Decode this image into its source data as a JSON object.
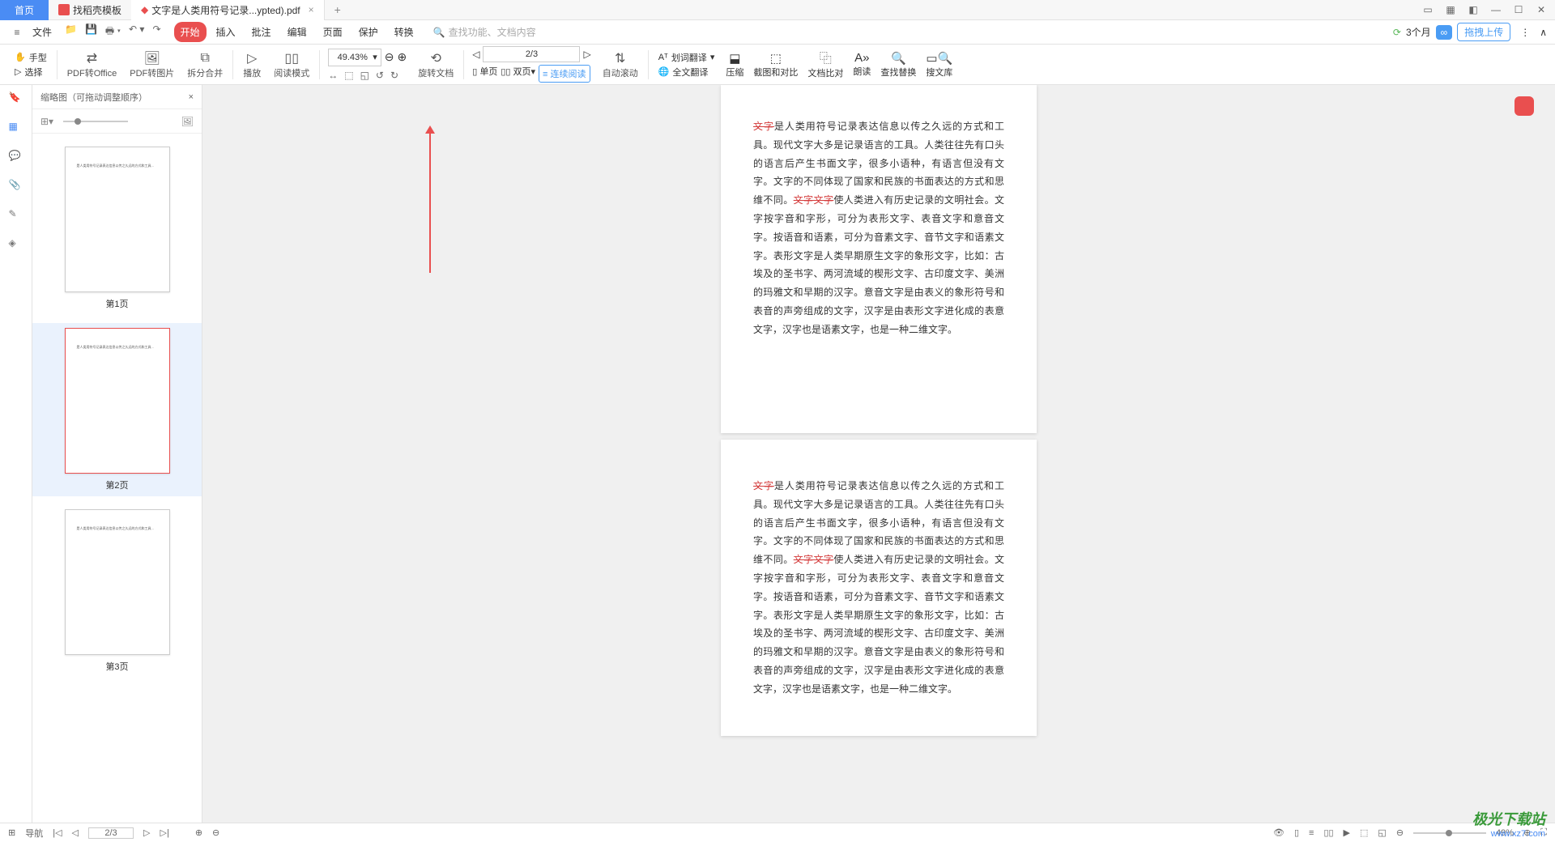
{
  "titlebar": {
    "home_tab": "首页",
    "store_tab": "找稻壳模板",
    "doc_tab": "文字是人类用符号记录...ypted).pdf"
  },
  "menubar": {
    "file": "文件",
    "tabs": [
      "开始",
      "插入",
      "批注",
      "编辑",
      "页面",
      "保护",
      "转换"
    ],
    "search_placeholder": "查找功能、文档内容",
    "cloud_text": "3个月",
    "upload": "拖拽上传"
  },
  "ribbon_left": {
    "hand": "手型",
    "select": "选择"
  },
  "ribbon": {
    "pdf_office": "PDF转Office",
    "pdf_image": "PDF转图片",
    "split_merge": "拆分合并",
    "play": "播放",
    "read_mode": "阅读模式",
    "zoom_value": "49.43%",
    "rotate": "旋转文档",
    "single_page": "单页",
    "double_page": "双页",
    "continuous": "连续阅读",
    "auto_scroll": "自动滚动",
    "page_indicator": "2/3",
    "word_translate": "划词翻译",
    "full_translate": "全文翻译",
    "compress": "压缩",
    "screenshot": "截图和对比",
    "file_compare": "文档比对",
    "read_aloud": "朗读",
    "find_replace": "查找替换",
    "search_lib": "搜文库"
  },
  "thumb": {
    "title": "缩略图（可拖动调整顺序）",
    "pages": [
      "第1页",
      "第2页",
      "第3页"
    ]
  },
  "doc_text": "是人类用符号记录表达信息以传之久远的方式和工具。现代文字大多是记录语言的工具。人类往往先有口头的语言后产生书面文字，很多小语种，有语言但没有文字。文字的不同体现了国家和民族的书面表达的方式和思维不同。",
  "doc_red1": "文字",
  "doc_red2": "文字文字",
  "doc_text2": "使人类进入有历史记录的文明社会。文字按字音和字形，可分为表形文字、表音文字和意音文字。按语音和语素，可分为音素文字、音节文字和语素文字。表形文字是人类早期原生文字的象形文字，比如：古埃及的圣书字、两河流域的楔形文字、古印度文字、美洲的玛雅文和早期的汉字。意音文字是由表义的象形符号和表音的声旁组成的文字，汉字是由表形文字进化成的表意文字，汉字也是语素文字，也是一种二维文字。",
  "statusbar": {
    "nav": "导航",
    "page": "2/3",
    "zoom": "49%"
  },
  "watermark": {
    "brand": "极光下载站",
    "site": "www.xz7.com"
  }
}
